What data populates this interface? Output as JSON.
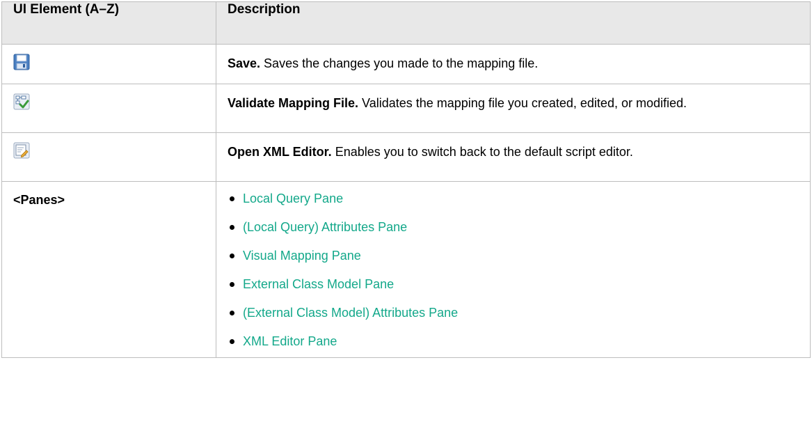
{
  "table": {
    "headers": {
      "element": "UI Element (A–Z)",
      "description": "Description"
    },
    "rows": {
      "save": {
        "icon": "save-icon",
        "name": "Save.",
        "text": " Saves the changes you made to the mapping file."
      },
      "validate": {
        "icon": "validate-mapping-icon",
        "name": "Validate Mapping File.",
        "text": " Validates the mapping file you created, edited, or modified."
      },
      "xml_editor": {
        "icon": "xml-editor-icon",
        "name": "Open XML Editor.",
        "text": " Enables you to switch back to the default script editor."
      },
      "panes": {
        "label": "<Panes>",
        "links": [
          "Local Query Pane",
          "(Local Query) Attributes Pane",
          "Visual Mapping Pane",
          "External Class Model Pane",
          "(External Class Model) Attributes Pane",
          "XML Editor Pane"
        ]
      }
    }
  },
  "colors": {
    "link": "#13a88a",
    "header_bg": "#e8e8e8",
    "border": "#bdbdbd"
  }
}
